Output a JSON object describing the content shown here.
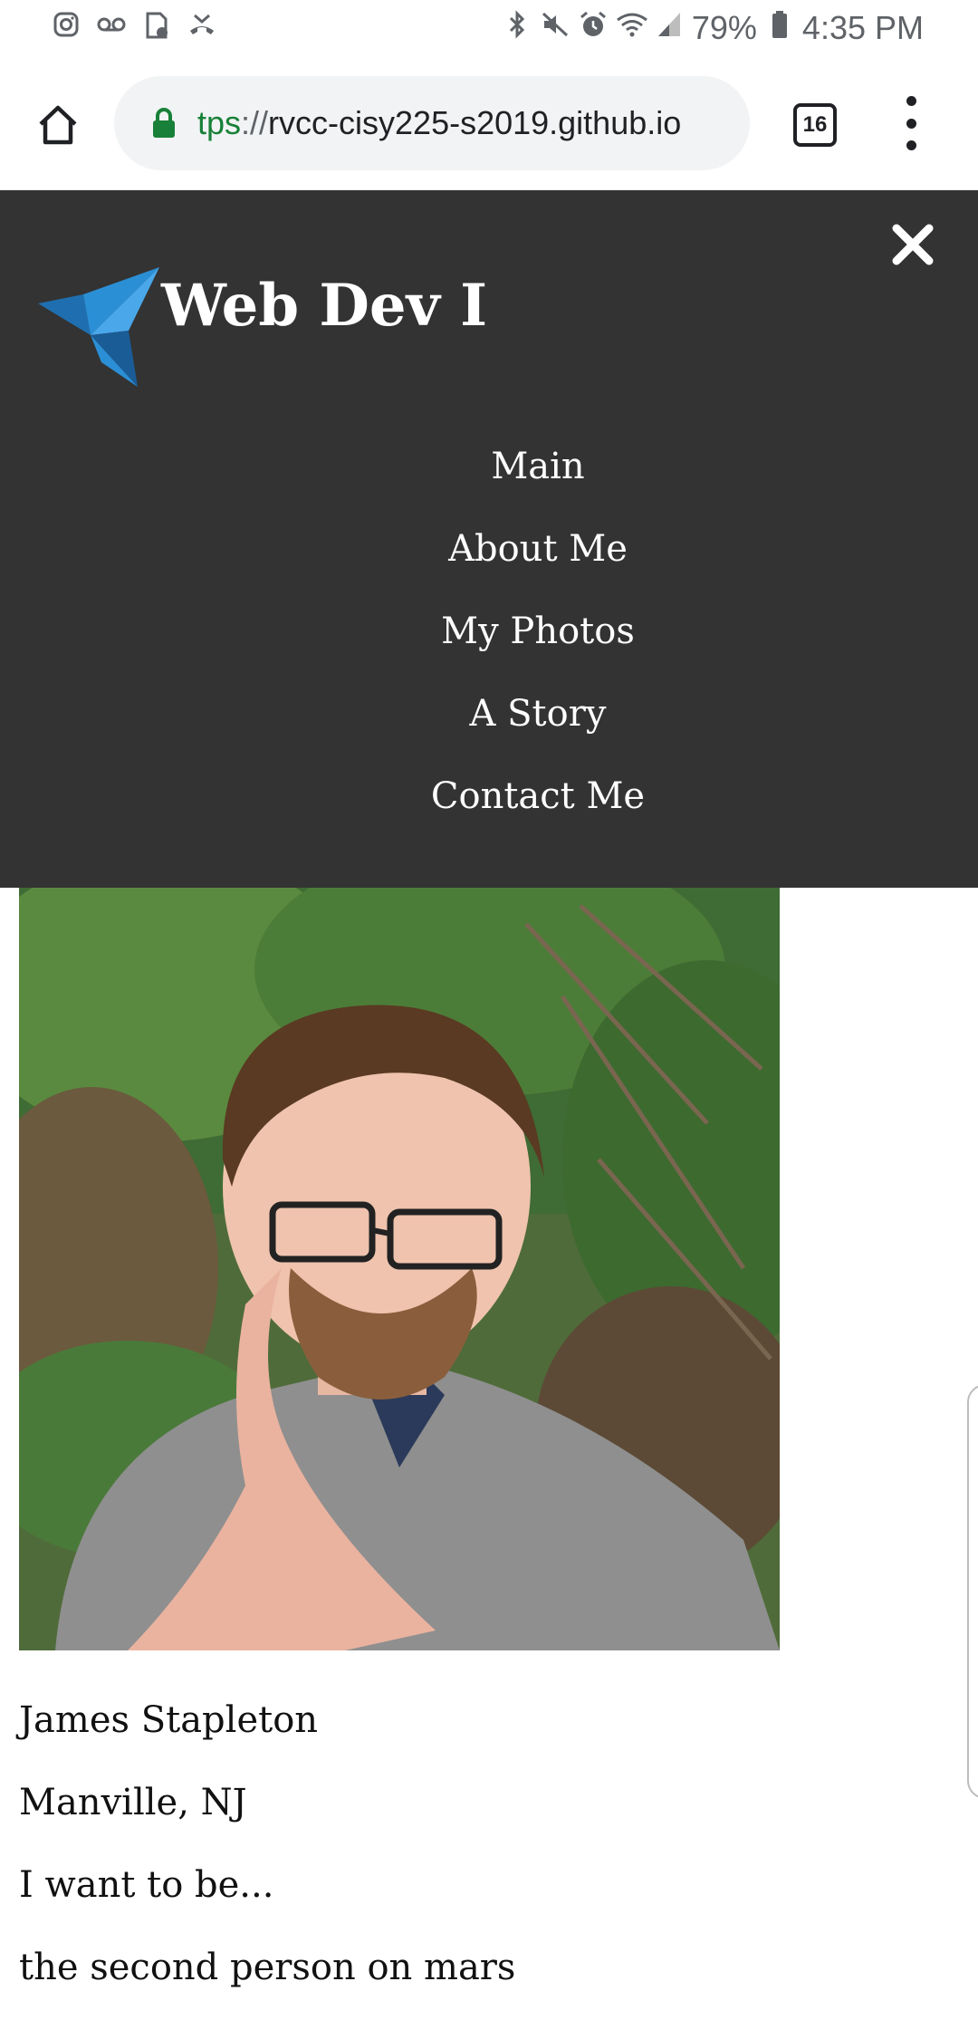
{
  "status_bar": {
    "battery": "79%",
    "time": "4:35 PM",
    "left_icons": [
      "instagram-icon",
      "voicemail-icon",
      "sim-card-icon",
      "missed-call-icon"
    ],
    "right_icons": [
      "bluetooth-icon",
      "mute-icon",
      "alarm-icon",
      "wifi-icon",
      "cell-signal-icon",
      "battery-icon"
    ]
  },
  "browser": {
    "url_scheme": "tps",
    "url_sep": "://",
    "url_host": "rvcc-cisy225-s2019.github.io",
    "tab_count": "16"
  },
  "site": {
    "title": "Web Dev I",
    "nav": [
      "Main",
      "About Me",
      "My Photos",
      "A Story",
      "Contact Me"
    ]
  },
  "profile": {
    "lines": [
      "James Stapleton",
      "Manville, NJ",
      "I want to be...",
      "the second person on mars"
    ]
  },
  "colors": {
    "nav_bg": "#333333",
    "logo_blue": "#2b8fd6",
    "url_green": "#188038"
  }
}
